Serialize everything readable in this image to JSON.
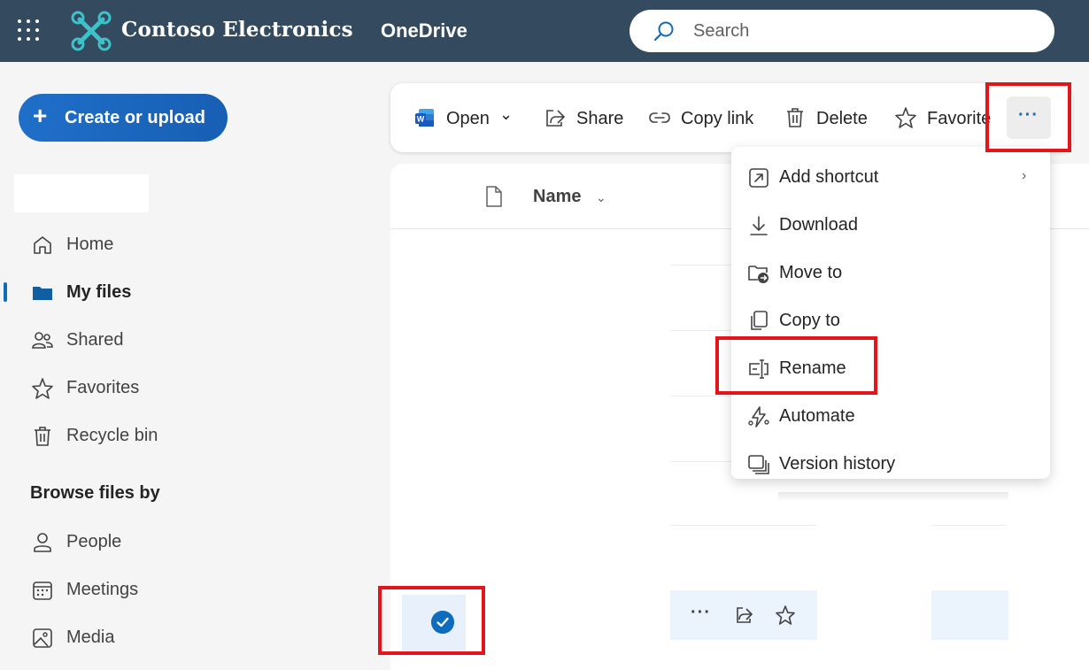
{
  "header": {
    "brand": "Contoso Electronics",
    "app_name": "OneDrive",
    "search_placeholder": "Search"
  },
  "sidebar": {
    "create_button": "Create or upload",
    "items": [
      {
        "label": "Home",
        "icon": "home-icon"
      },
      {
        "label": "My files",
        "icon": "folder-icon",
        "active": true
      },
      {
        "label": "Shared",
        "icon": "people-icon"
      },
      {
        "label": "Favorites",
        "icon": "star-icon"
      },
      {
        "label": "Recycle bin",
        "icon": "trash-icon"
      }
    ],
    "browse_title": "Browse files by",
    "browse_items": [
      {
        "label": "People",
        "icon": "person-icon"
      },
      {
        "label": "Meetings",
        "icon": "calendar-icon"
      },
      {
        "label": "Media",
        "icon": "image-icon"
      }
    ]
  },
  "commandbar": {
    "open": "Open",
    "share": "Share",
    "copy_link": "Copy link",
    "delete": "Delete",
    "favorite": "Favorite",
    "more": "···"
  },
  "list": {
    "name_header": "Name",
    "row_more": "···"
  },
  "menu": {
    "items": [
      {
        "label": "Add shortcut",
        "icon": "add-shortcut-icon"
      },
      {
        "label": "Download",
        "icon": "download-icon"
      },
      {
        "label": "Move to",
        "icon": "move-to-icon"
      },
      {
        "label": "Copy to",
        "icon": "copy-to-icon"
      },
      {
        "label": "Rename",
        "icon": "rename-icon"
      },
      {
        "label": "Automate",
        "icon": "automate-icon"
      },
      {
        "label": "Version history",
        "icon": "version-history-icon"
      }
    ]
  },
  "colors": {
    "topbar": "#344a5e",
    "accent": "#0f6cbd",
    "annotation": "#e3151b"
  }
}
